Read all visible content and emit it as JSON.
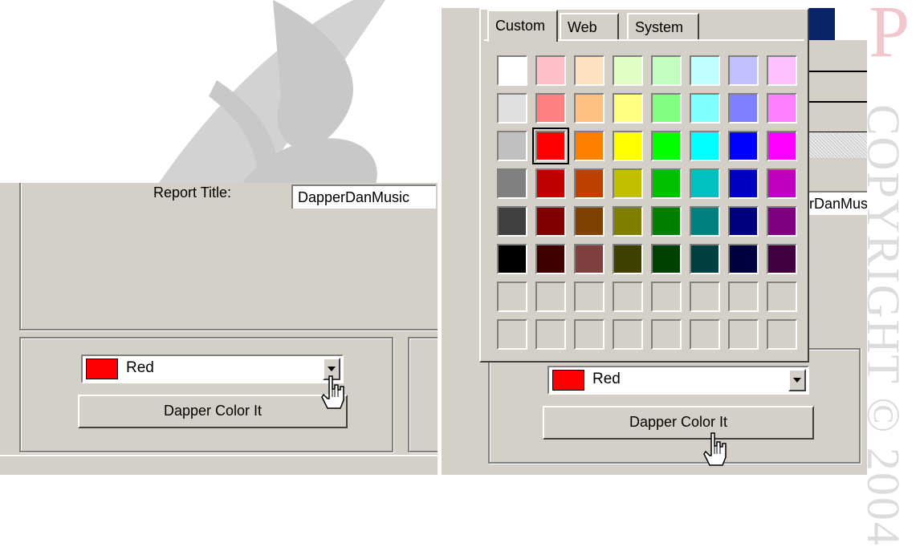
{
  "left_panel": {
    "report_title_label": "Report Title:",
    "report_title_value": "DapperDanMusic",
    "color_combo_value": "Red",
    "color_button_label": "Dapper Color It"
  },
  "right_panel": {
    "report_title_value_partial": "erDanMusic",
    "color_combo_value": "Red",
    "color_button_label": "Dapper Color It"
  },
  "color_picker": {
    "tabs": [
      "Custom",
      "Web",
      "System"
    ],
    "active_tab": "Custom",
    "selected_color": "#ff0000",
    "palette_rows": [
      [
        "#ffffff",
        "#ffc0c8",
        "#ffe0c0",
        "#e0ffc0",
        "#c0ffc0",
        "#c0ffff",
        "#c0c0ff",
        "#ffc0ff"
      ],
      [
        "#e0e0e0",
        "#ff8080",
        "#ffc080",
        "#ffff80",
        "#80ff80",
        "#80ffff",
        "#8080ff",
        "#ff80ff"
      ],
      [
        "#c0c0c0",
        "#ff0000",
        "#ff8000",
        "#ffff00",
        "#00ff00",
        "#00ffff",
        "#0000ff",
        "#ff00ff"
      ],
      [
        "#808080",
        "#c00000",
        "#c04000",
        "#c0c000",
        "#00c000",
        "#00c0c0",
        "#0000c0",
        "#c000c0"
      ],
      [
        "#404040",
        "#800000",
        "#804000",
        "#808000",
        "#008000",
        "#008080",
        "#000080",
        "#800080"
      ],
      [
        "#000000",
        "#400000",
        "#804040",
        "#404000",
        "#004000",
        "#004040",
        "#000040",
        "#400040"
      ],
      [
        null,
        null,
        null,
        null,
        null,
        null,
        null,
        null
      ],
      [
        null,
        null,
        null,
        null,
        null,
        null,
        null,
        null
      ]
    ]
  },
  "watermark": {
    "copyright_text": "COPYRIGHT © 2004",
    "logo_letter": "P"
  },
  "colors": {
    "window_face": "#d4d0c8",
    "selection_blue": "#0a246a",
    "red": "#ff0000"
  }
}
